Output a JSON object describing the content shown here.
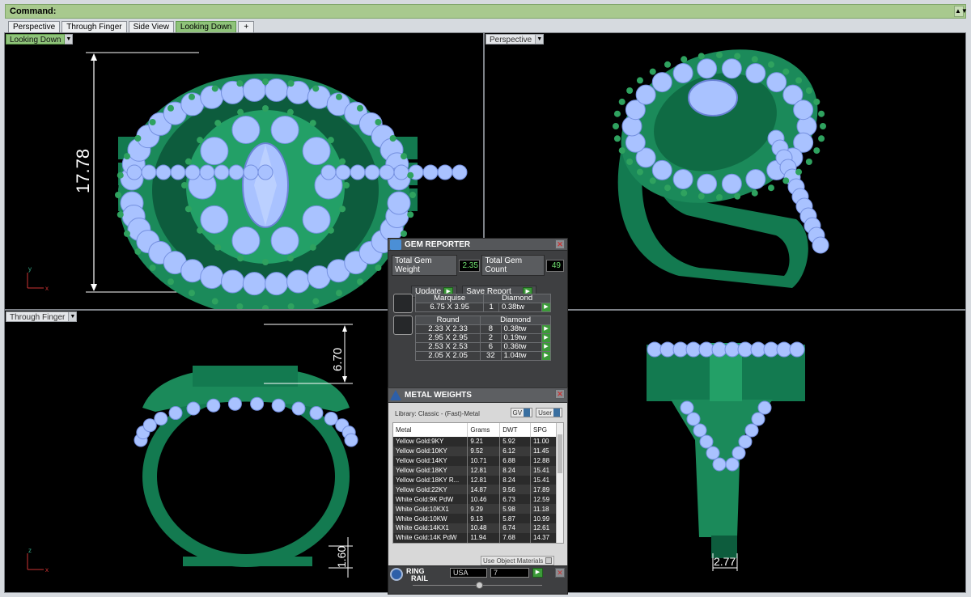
{
  "command": {
    "label": "Command:"
  },
  "tabs": [
    {
      "label": "Perspective",
      "active": false
    },
    {
      "label": "Through Finger",
      "active": false
    },
    {
      "label": "Side View",
      "active": false
    },
    {
      "label": "Looking Down",
      "active": true
    },
    {
      "label": "+",
      "active": false
    }
  ],
  "viewports": {
    "top_left": {
      "label": "Looking Down",
      "dimension": "17.78",
      "axis_x": "x",
      "axis_y": "y"
    },
    "top_right": {
      "label": "Perspective"
    },
    "bottom_left": {
      "label": "Through Finger",
      "dimension_top": "6.70",
      "dimension_bottom": "1.60",
      "axis_x": "x",
      "axis_y": "z"
    },
    "bottom_right": {
      "dimension": "2.77"
    }
  },
  "gem_reporter": {
    "title": "GEM REPORTER",
    "total_weight_label": "Total Gem Weight",
    "total_weight_value": "2.35",
    "total_count_label": "Total Gem Count",
    "total_count_value": "49",
    "update_label": "Update",
    "save_report_label": "Save Report",
    "groups": [
      {
        "shape": "Marquise",
        "material": "Diamond",
        "rows": [
          {
            "size": "6.75 X 3.95",
            "count": "1",
            "weight": "0.38tw"
          }
        ]
      },
      {
        "shape": "Round",
        "material": "Diamond",
        "rows": [
          {
            "size": "2.33 X 2.33",
            "count": "8",
            "weight": "0.38tw"
          },
          {
            "size": "2.95 X 2.95",
            "count": "2",
            "weight": "0.19tw"
          },
          {
            "size": "2.53 X 2.53",
            "count": "6",
            "weight": "0.36tw"
          },
          {
            "size": "2.05 X 2.05",
            "count": "32",
            "weight": "1.04tw"
          }
        ]
      }
    ]
  },
  "metal_weights": {
    "title": "METAL WEIGHTS",
    "library": "Library: Classic - (Fast)-Metal",
    "btn_gv": "GV",
    "btn_user": "User",
    "columns": [
      "Metal",
      "Grams",
      "DWT",
      "SPG"
    ],
    "rows": [
      [
        "Yellow Gold:9KY",
        "9.21",
        "5.92",
        "11.00"
      ],
      [
        "Yellow Gold:10KY",
        "9.52",
        "6.12",
        "11.45"
      ],
      [
        "Yellow Gold:14KY",
        "10.71",
        "6.88",
        "12.88"
      ],
      [
        "Yellow Gold:18KY",
        "12.81",
        "8.24",
        "15.41"
      ],
      [
        "Yellow Gold:18KY R...",
        "12.81",
        "8.24",
        "15.41"
      ],
      [
        "Yellow Gold:22KY",
        "14.87",
        "9.56",
        "17.89"
      ],
      [
        "White Gold:9K PdW",
        "10.46",
        "6.73",
        "12.59"
      ],
      [
        "White Gold:10KX1",
        "9.29",
        "5.98",
        "11.18"
      ],
      [
        "White Gold:10KW",
        "9.13",
        "5.87",
        "10.99"
      ],
      [
        "White Gold:14KX1",
        "10.48",
        "6.74",
        "12.61"
      ],
      [
        "White Gold:14K PdW",
        "11.94",
        "7.68",
        "14.37"
      ]
    ],
    "use_object_materials": "Use Object Materials"
  },
  "ring_rail": {
    "title_line1": "RING",
    "title_line2": "RAIL",
    "standard": "USA",
    "size": "7"
  },
  "colors": {
    "metal": "#1d7a52",
    "gem": "#a9c2ff",
    "prong": "#2fa25f",
    "active_tab": "#8fc37a"
  }
}
